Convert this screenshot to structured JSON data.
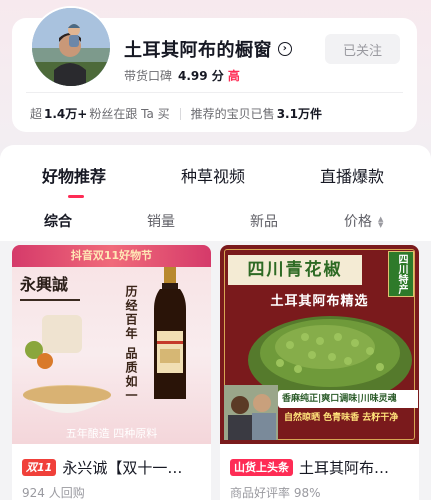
{
  "profile": {
    "shop_name": "土耳其阿布的橱窗",
    "follow_label": "已关注",
    "rating_label": "带货口碑",
    "rating_score": "4.99 分",
    "rating_level": "高",
    "stats": {
      "fans_prefix": "超",
      "fans_count": "1.4万+",
      "fans_suffix": "粉丝在跟 Ta 买",
      "sold_prefix": "推荐的宝贝已售",
      "sold_count": "3.1万件"
    }
  },
  "tabs": [
    {
      "label": "好物推荐",
      "active": true
    },
    {
      "label": "种草视频",
      "active": false
    },
    {
      "label": "直播爆款",
      "active": false
    }
  ],
  "sort": [
    {
      "label": "综合",
      "active": true
    },
    {
      "label": "销量",
      "active": false
    },
    {
      "label": "新品",
      "active": false
    },
    {
      "label": "价格",
      "active": false
    }
  ],
  "products": [
    {
      "tag": "双11",
      "title": "永兴诚【双十一…",
      "sub": "924 人回购",
      "image_text": {
        "banner": "抖音双11好物节",
        "brand": "永興誠",
        "slogan": "历经百年 品质如一",
        "footer": "五年酿造 四种原料"
      }
    },
    {
      "tag": "山货上头条",
      "title": "土耳其阿布…",
      "sub": "商品好评率 98%",
      "image_text": {
        "title": "四川青花椒",
        "origin": "四川特产",
        "subtitle": "土耳其阿布精选",
        "badge": "香麻纯正|爽口调味|川味灵魂",
        "footer": "自然晾晒 色青味香 去籽干净"
      }
    }
  ],
  "colors": {
    "accent": "#fe2c55",
    "page_bg": "#f3eef2"
  }
}
